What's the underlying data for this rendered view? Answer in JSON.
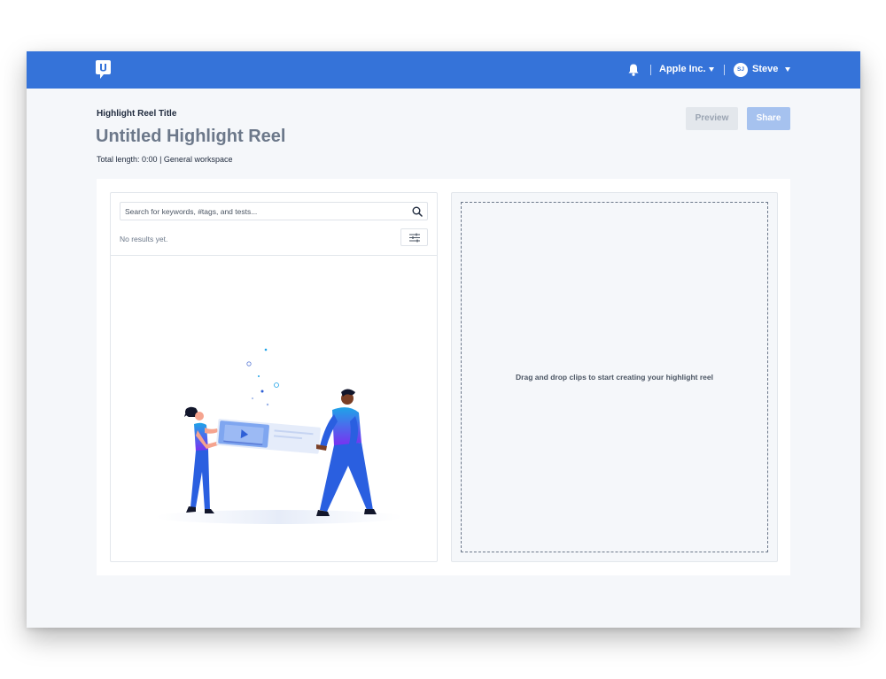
{
  "header": {
    "organization": "Apple Inc.",
    "user_initials": "SJ",
    "user_name": "Steve"
  },
  "page": {
    "label": "Highlight Reel Title",
    "title": "Untitled Highlight Reel",
    "meta_prefix": "Total length: ",
    "total_length": "0:00",
    "meta_separator": " | ",
    "workspace": "General workspace"
  },
  "actions": {
    "preview_label": "Preview",
    "share_label": "Share"
  },
  "search": {
    "placeholder": "Search for keywords, #tags, and tests...",
    "no_results": "No results yet."
  },
  "dropzone": {
    "text": "Drag and drop clips to start creating your highlight reel"
  },
  "colors": {
    "brand": "#3573d9",
    "title": "#6c788a",
    "share_disabled": "#a6c2ef"
  },
  "icons": [
    "logo-icon",
    "bell-icon",
    "caret-down-icon",
    "search-icon",
    "filter-icon"
  ]
}
